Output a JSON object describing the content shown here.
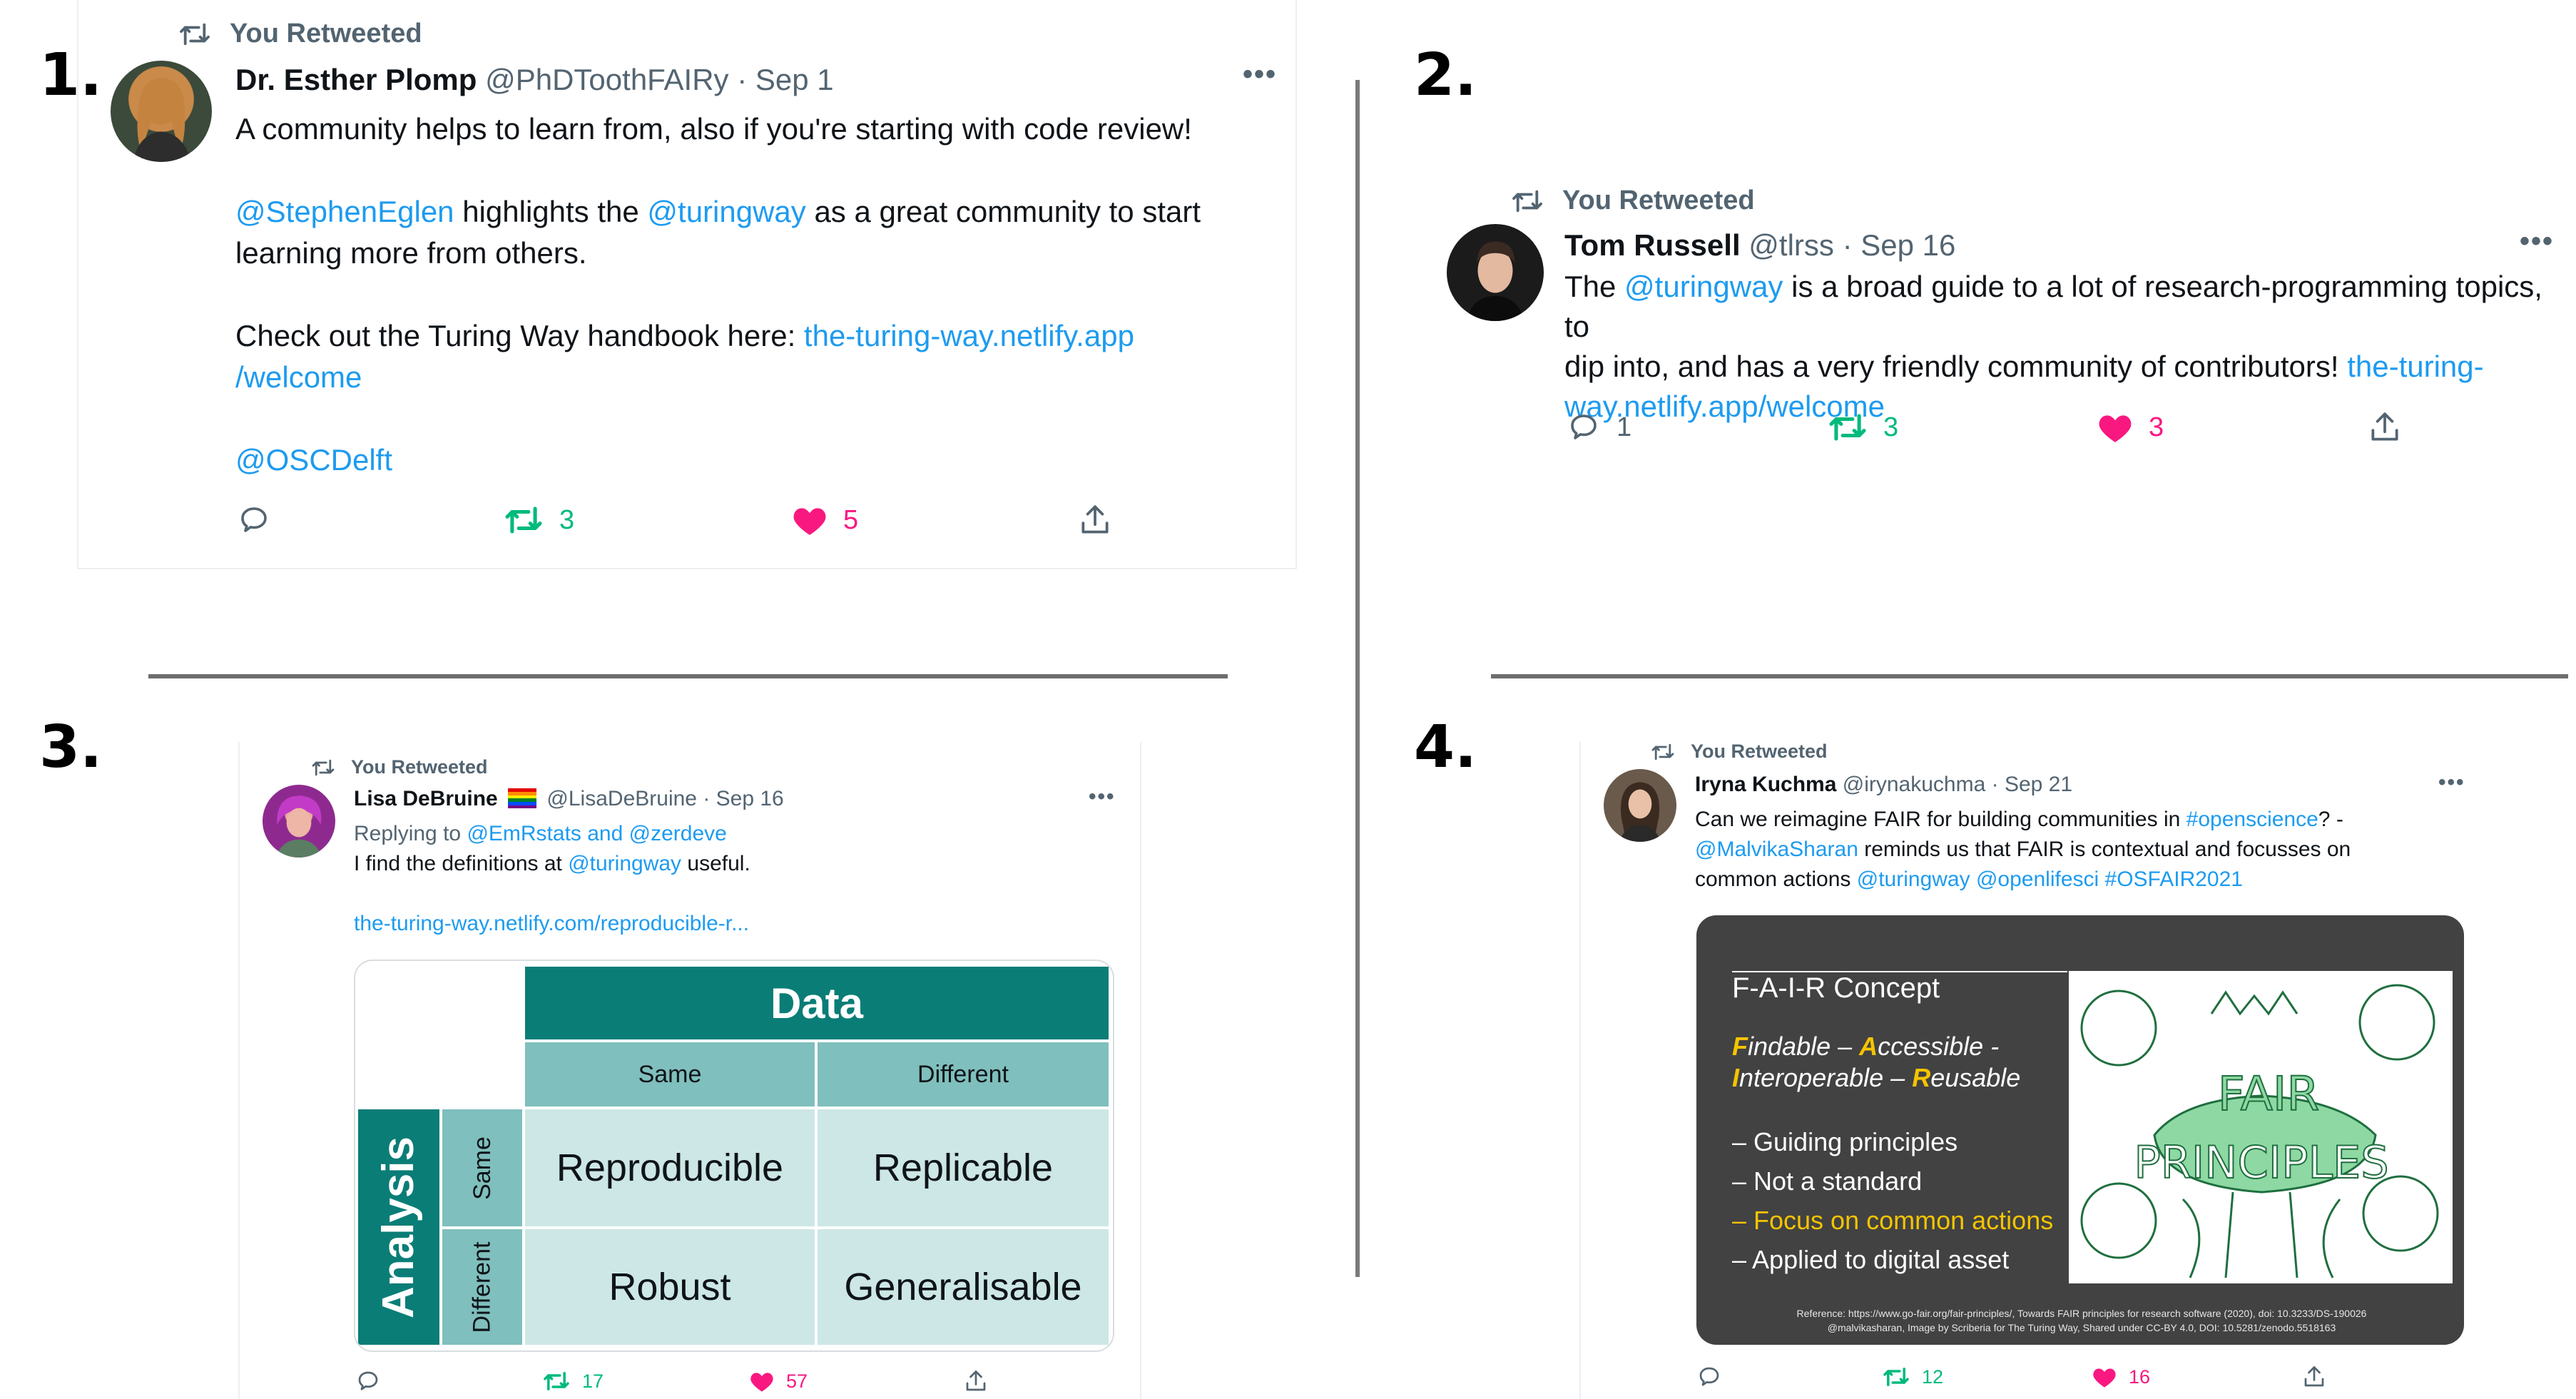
{
  "panel_labels": [
    "1.",
    "2.",
    "3.",
    "4."
  ],
  "retweet_label": "You Retweeted",
  "tweets": [
    {
      "author": "Dr. Esther Plomp",
      "handle": "@PhDToothFAIRy",
      "date": "Sep 1",
      "lines": [
        [
          "A community helps to learn from, also if you're starting with code review!"
        ],
        [
          "@StephenEglen",
          " highlights the ",
          "@turingway",
          " as a great community to start"
        ],
        [
          "learning more from others."
        ],
        [
          "Check out the Turing Way handbook here: ",
          "the-turing-way.netlify.app"
        ],
        [
          "/welcome"
        ],
        [
          "@OSCDelft"
        ]
      ],
      "replies": "",
      "retweets": "3",
      "likes": "5"
    },
    {
      "author": "Tom Russell",
      "handle": "@tlrss",
      "date": "Sep 16",
      "lines": [
        [
          "The ",
          "@turingway",
          " is a broad guide to a lot of research-programming topics, to"
        ],
        [
          "dip into, and has a very friendly community of contributors! ",
          "the-turing-"
        ],
        [
          "way.netlify.app/welcome"
        ]
      ],
      "replies": "1",
      "retweets": "3",
      "likes": "3"
    },
    {
      "author": "Lisa DeBruine",
      "handle": "@LisaDeBruine",
      "date": "Sep 16",
      "replying_prefix": "Replying to ",
      "replying_to": "@EmRstats and @zerdeve",
      "lines": [
        [
          "I find the definitions at ",
          "@turingway",
          " useful."
        ],
        [
          "the-turing-way.netlify.com/reproducible-r..."
        ]
      ],
      "replies": "",
      "retweets": "17",
      "likes": "57",
      "table": {
        "data_header": "Data",
        "analysis_header": "Analysis",
        "col_same": "Same",
        "col_different": "Different",
        "row_same": "Same",
        "row_different": "Different",
        "cells": [
          "Reproducible",
          "Replicable",
          "Robust",
          "Generalisable"
        ],
        "colors": {
          "dark": "#0a7d77",
          "mid": "#7fbfbd",
          "light": "#cce7e5"
        }
      }
    },
    {
      "author": "Iryna Kuchma",
      "handle": "@irynakuchma",
      "date": "Sep 21",
      "lines": [
        [
          "Can we reimagine FAIR for building communities in ",
          "#openscience",
          "? -"
        ],
        [
          "@MalvikaSharan",
          " reminds us that FAIR is contextual and focusses on"
        ],
        [
          "common actions ",
          "@turingway",
          " ",
          "@openlifesci",
          " ",
          "#OSFAIR2021"
        ]
      ],
      "replies": "",
      "retweets": "12",
      "likes": "16",
      "slide": {
        "title": "F-A-I-R Concept",
        "line1": [
          [
            "F",
            "indable – "
          ],
          [
            "A",
            "ccessible -"
          ]
        ],
        "line2": [
          [
            "I",
            "nteroperable – "
          ],
          [
            "R",
            "eusable"
          ]
        ],
        "bullets": [
          "– Guiding principles",
          "– Not a standard",
          "– Focus on common actions",
          "– Applied to digital asset"
        ],
        "illustration_word1": "FAIR",
        "illustration_word2": "PRINCIPLES",
        "ref1": "Reference: https://www.go-fair.org/fair-principles/, Towards FAIR principles for research software (2020), doi: 10.3233/DS-190026",
        "ref2": "@malvikasharan, Image by Scriberia for The Turing Way, Shared under CC-BY 4.0, DOI: 10.5281/zenodo.5518163",
        "colors": {
          "bg": "#424242",
          "yellow": "#f5c400",
          "green": "#8ed8a3",
          "ink": "#1f6f3f"
        }
      }
    }
  ],
  "colors": {
    "link": "#1d9bf0",
    "retweet": "#00ba7c",
    "like": "#f91880",
    "muted": "#536471"
  }
}
